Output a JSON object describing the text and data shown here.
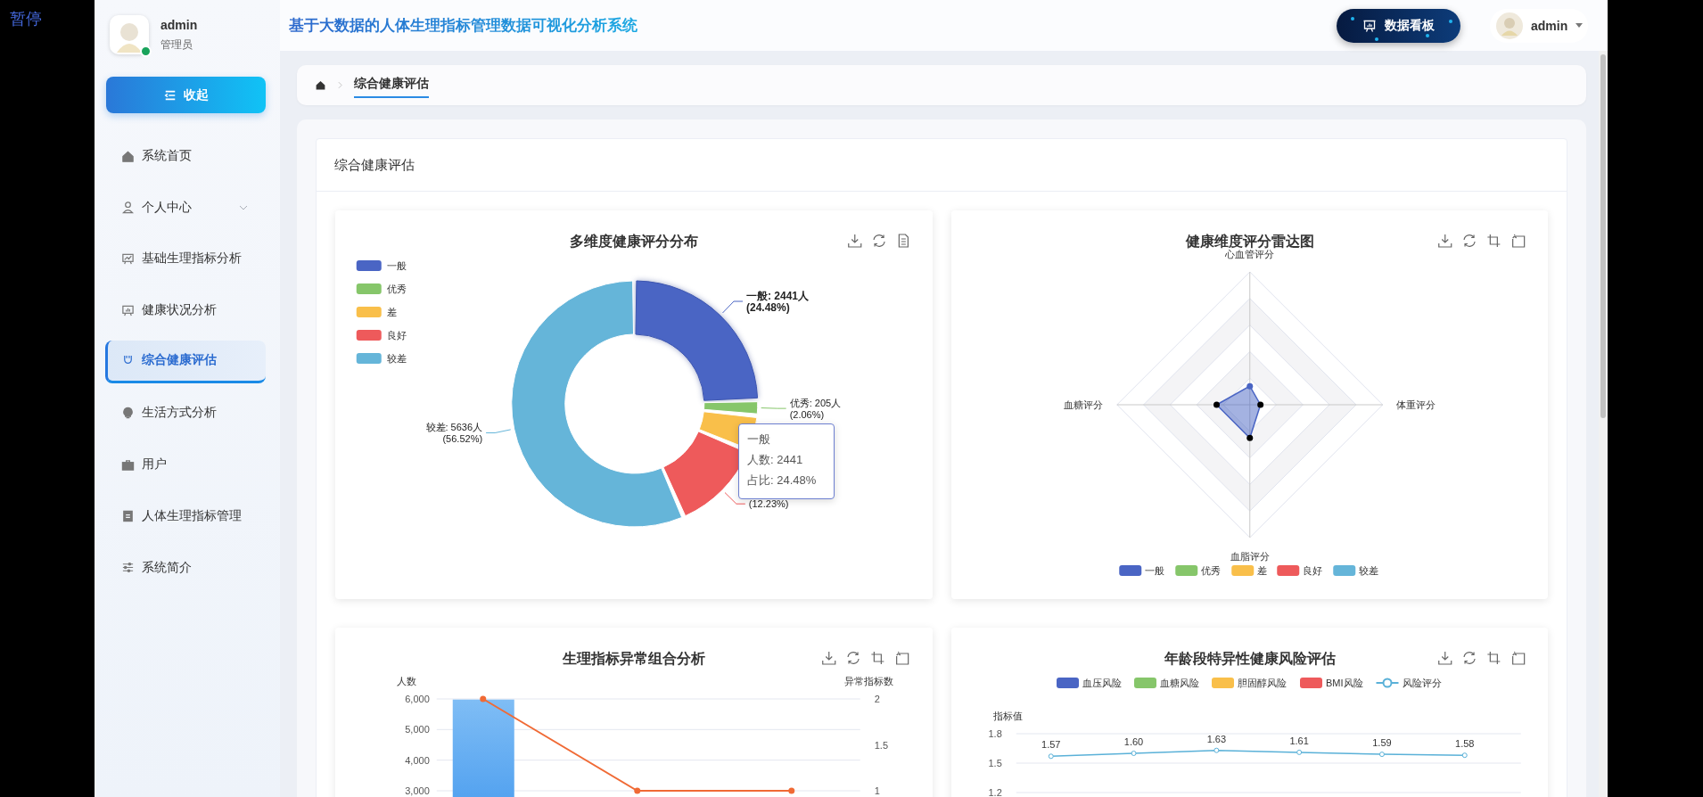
{
  "overlay_label": "暂停",
  "sidebar": {
    "user": {
      "name": "admin",
      "role": "管理员",
      "online": true
    },
    "collapse_button": "收起",
    "items": [
      {
        "label": "系统首页",
        "selected": false
      },
      {
        "label": "个人中心",
        "selected": false,
        "expanded": false
      },
      {
        "label": "基础生理指标分析",
        "selected": false
      },
      {
        "label": "健康状况分析",
        "selected": false
      },
      {
        "label": "综合健康评估",
        "selected": true
      },
      {
        "label": "生活方式分析",
        "selected": false
      },
      {
        "label": "用户",
        "selected": false
      },
      {
        "label": "人体生理指标管理",
        "selected": false
      },
      {
        "label": "系统简介",
        "selected": false
      }
    ]
  },
  "header": {
    "title": "基于大数据的人体生理指标管理数据可视化分析系统",
    "dashboard_button": "数据看板",
    "user": "admin"
  },
  "breadcrumb": [
    {
      "label": "综合健康评估",
      "selected": true
    }
  ],
  "panel": {
    "title": "综合健康评估"
  },
  "charts": [
    {
      "title": "多维度健康评分分布",
      "toolbox": [
        {
          "kind": "download"
        },
        {
          "kind": "refresh"
        },
        {
          "kind": "data_view"
        }
      ],
      "chart_data": {
        "type": "donut",
        "categories": [
          "一般",
          "优秀",
          "差",
          "良好",
          "较差"
        ],
        "values": [
          24.48,
          2.06,
          4.71,
          12.23,
          56.52
        ],
        "colors": [
          "#4a65c4",
          "#86c66a",
          "#f9bf4a",
          "#ee5a5b",
          "#65b5d9"
        ],
        "legend": true,
        "value_labels": [
          "一般: 2441人\n(24.48%)",
          "优秀: 205人\n(2.06%)",
          null,
          "(12.23%)",
          "较差: 5636人\n(56.52%)"
        ]
      },
      "highlighted": [
        true,
        false,
        false,
        false,
        false
      ],
      "tooltip": {
        "title": "一般",
        "lines": [
          "人数: 2441",
          "占比: 24.48%"
        ]
      }
    },
    {
      "kind": "radar",
      "title": "健康维度评分雷达图",
      "toolbox": [
        {
          "kind": "download"
        },
        {
          "kind": "refresh"
        },
        {
          "kind": "zoom"
        },
        {
          "kind": "zoom_reset"
        }
      ],
      "indicators": [
        "心血管评分",
        "体重评分",
        "血脂评分",
        "血糖评分"
      ],
      "legend": [
        {
          "label": "一般",
          "color": "#4a65c4"
        },
        {
          "label": "优秀",
          "color": "#86c66a"
        },
        {
          "label": "差",
          "color": "#f9bf4a"
        },
        {
          "label": "良好",
          "color": "#ee5a5b"
        },
        {
          "label": "较差",
          "color": "#65b5d9"
        }
      ]
    },
    {
      "title": "生理指标异常组合分析",
      "toolbox": [
        {
          "kind": "download"
        },
        {
          "kind": "refresh"
        },
        {
          "kind": "zoom"
        },
        {
          "kind": "zoom_reset"
        }
      ],
      "chart_data": {
        "type": "bar",
        "grid": true,
        "ylabel": "人数",
        "y2label": "异常指标数",
        "ylim": [
          0,
          6000
        ],
        "y2lim": [
          0,
          2
        ],
        "yticks": [
          {
            "value": 3000,
            "label": "3,000"
          },
          {
            "value": 4000,
            "label": "4,000"
          },
          {
            "value": 5000,
            "label": "5,000"
          },
          {
            "value": 6000,
            "label": "6,000"
          }
        ],
        "y2ticks": [
          1,
          1.5,
          2
        ],
        "series": [
          {
            "color": "#2f8ceb",
            "values": [
              5980,
              null,
              null
            ]
          },
          {
            "color": "#f06a35",
            "type": "line",
            "axis": "y2",
            "marker": "circle",
            "values": [
              2,
              1,
              1
            ]
          }
        ]
      }
    },
    {
      "title": "年龄段特异性健康风险评估",
      "toolbox": [
        {
          "kind": "download"
        },
        {
          "kind": "refresh"
        },
        {
          "kind": "zoom"
        },
        {
          "kind": "zoom_reset"
        }
      ],
      "legend": [
        {
          "label": "血压风险",
          "color": "#4a65c4"
        },
        {
          "label": "血糖风险",
          "color": "#86c66a"
        },
        {
          "label": "胆固醇风险",
          "color": "#f9bf4a"
        },
        {
          "label": "BMI风险",
          "color": "#ee5a5b"
        }
      ],
      "chart_data": {
        "type": "line",
        "grid": true,
        "ylabel": "指标值",
        "ylim": [
          1.2,
          1.8
        ],
        "yticks": [
          1.2,
          1.5,
          1.8
        ],
        "series": [
          {
            "name": "风险评分",
            "color": "#5ab1d8",
            "marker": "circle",
            "values": [
              1.57,
              1.6,
              1.63,
              1.61,
              1.59,
              1.58
            ],
            "value_labels": [
              "1.57",
              "1.60",
              "1.63",
              "1.61",
              "1.59",
              "1.58"
            ]
          }
        ]
      }
    }
  ]
}
